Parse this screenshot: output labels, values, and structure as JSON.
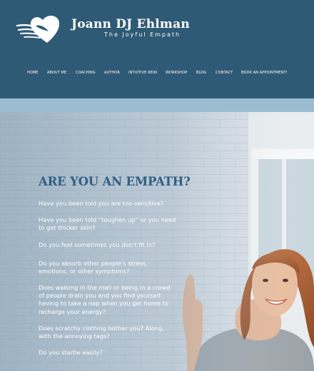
{
  "brand": {
    "name": "Joann DJ Ehlman",
    "tagline": "The Joyful Empath",
    "logo_icon": "heart-bird-icon"
  },
  "nav": {
    "items": [
      "HOME",
      "ABOUT ME",
      "COACHING",
      "AUTHOR",
      "INTUITIVE REIKI",
      "WORKSHOP",
      "BLOG",
      "CONTACT",
      "BOOK AN APPOINTMENT!"
    ]
  },
  "hero": {
    "headline": "ARE YOU AN EMPATH?",
    "questions": [
      [
        "Have you been told you are too sensitive?"
      ],
      [
        "Have you been told “toughen up” or you need",
        "to get thicker skin?"
      ],
      [
        "Do you feel sometimes you don’t fit in?"
      ],
      [
        "Do you absorb other people’s stress,",
        "emotions, or other symptoms?"
      ],
      [
        "Does walking in the mall or being in a crowd",
        "of people drain you and you find yourself",
        "having to take a nap when you get home to",
        "recharge your energy?"
      ],
      [
        "Does scratchy clothing bother you? Along,",
        "with the annoying tags?"
      ],
      [
        "Do you startle easily?"
      ]
    ]
  },
  "colors": {
    "header_bg": "#2f5a75",
    "strip": "#9bbdd2",
    "headline": "#2f5f86"
  }
}
